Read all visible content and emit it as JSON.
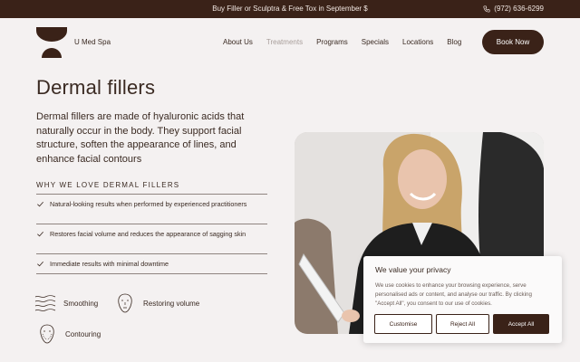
{
  "promo": {
    "message": "Buy Filler or Sculptra & Free Tox in September $",
    "phone": "(972) 636-6299",
    "phone_icon": "phone-icon"
  },
  "header": {
    "brand": "U Med Spa",
    "logo_icon": "brand-logo-icon",
    "nav": [
      "About Us",
      "Treatments",
      "Programs",
      "Specials",
      "Locations",
      "Blog"
    ],
    "active_nav": "Treatments",
    "cta": "Book Now"
  },
  "main": {
    "title": "Dermal fillers",
    "intro": "Dermal fillers are made of hyaluronic acids that naturally occur in the body. They support facial structure, soften the appearance of lines, and enhance facial contours",
    "why_heading": "WHY WE LOVE DERMAL FILLERS",
    "benefits": [
      "Natural-looking results when performed by experienced practitioners",
      "Restores facial volume and reduces the appearance of sagging skin",
      "Immediate results with minimal downtime"
    ],
    "features": [
      {
        "label": "Smoothing",
        "icon": "wavy-lines-icon"
      },
      {
        "label": "Restoring volume",
        "icon": "face-outline-icon"
      },
      {
        "label": "Contouring",
        "icon": "face-contour-icon"
      }
    ]
  },
  "cookie": {
    "title": "We value your privacy",
    "text": "We use cookies to enhance your browsing experience, serve personalised ads or content, and analyse our traffic. By clicking \"Accept All\", you consent to our use of cookies.",
    "customise": "Customise",
    "reject": "Reject All",
    "accept": "Accept All"
  },
  "colors": {
    "brand_dark": "#3a2218",
    "background": "#f4f1f1",
    "nav_active": "#a89e9a"
  }
}
